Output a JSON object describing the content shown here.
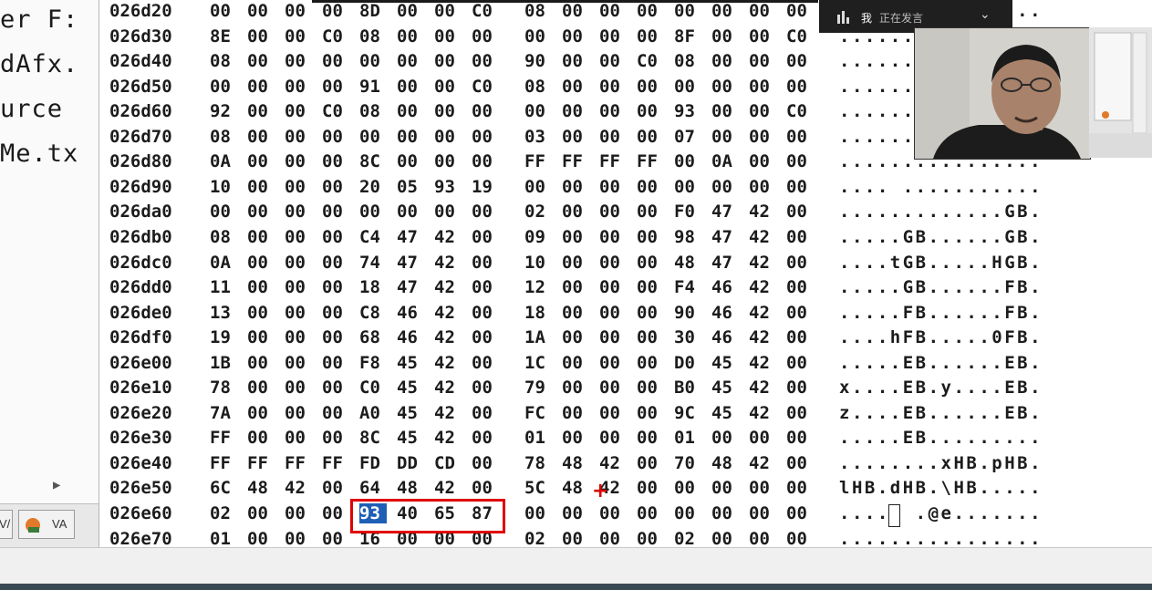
{
  "file_tree": {
    "items": [
      "er F:",
      "dAfx.",
      "urce ",
      "Me.tx"
    ],
    "tabs": [
      "V/",
      "VA"
    ]
  },
  "meeting": {
    "speaker": "我",
    "status": "正在发言"
  },
  "hex": {
    "selected_bytes": [
      "93",
      "40",
      "65",
      "87"
    ],
    "rows": [
      {
        "addr": "026d20",
        "bytes": [
          "00",
          "00",
          "00",
          "00",
          "8D",
          "00",
          "00",
          "C0",
          "08",
          "00",
          "00",
          "00",
          "00",
          "00",
          "00",
          "00"
        ],
        "ascii": "....  .........."
      },
      {
        "addr": "026d30",
        "bytes": [
          "8E",
          "00",
          "00",
          "C0",
          "08",
          "00",
          "00",
          "00",
          "00",
          "00",
          "00",
          "00",
          "8F",
          "00",
          "00",
          "C0"
        ],
        "ascii": "................"
      },
      {
        "addr": "026d40",
        "bytes": [
          "08",
          "00",
          "00",
          "00",
          "00",
          "00",
          "00",
          "00",
          "90",
          "00",
          "00",
          "C0",
          "08",
          "00",
          "00",
          "00"
        ],
        "ascii": "................"
      },
      {
        "addr": "026d50",
        "bytes": [
          "00",
          "00",
          "00",
          "00",
          "91",
          "00",
          "00",
          "C0",
          "08",
          "00",
          "00",
          "00",
          "00",
          "00",
          "00",
          "00"
        ],
        "ascii": "................"
      },
      {
        "addr": "026d60",
        "bytes": [
          "92",
          "00",
          "00",
          "C0",
          "08",
          "00",
          "00",
          "00",
          "00",
          "00",
          "00",
          "00",
          "93",
          "00",
          "00",
          "C0"
        ],
        "ascii": "................"
      },
      {
        "addr": "026d70",
        "bytes": [
          "08",
          "00",
          "00",
          "00",
          "00",
          "00",
          "00",
          "00",
          "03",
          "00",
          "00",
          "00",
          "07",
          "00",
          "00",
          "00"
        ],
        "ascii": "................"
      },
      {
        "addr": "026d80",
        "bytes": [
          "0A",
          "00",
          "00",
          "00",
          "8C",
          "00",
          "00",
          "00",
          "FF",
          "FF",
          "FF",
          "FF",
          "00",
          "0A",
          "00",
          "00"
        ],
        "ascii": "................"
      },
      {
        "addr": "026d90",
        "bytes": [
          "10",
          "00",
          "00",
          "00",
          "20",
          "05",
          "93",
          "19",
          "00",
          "00",
          "00",
          "00",
          "00",
          "00",
          "00",
          "00"
        ],
        "ascii": ".... ..........."
      },
      {
        "addr": "026da0",
        "bytes": [
          "00",
          "00",
          "00",
          "00",
          "00",
          "00",
          "00",
          "00",
          "02",
          "00",
          "00",
          "00",
          "F0",
          "47",
          "42",
          "00"
        ],
        "ascii": ".............GB."
      },
      {
        "addr": "026db0",
        "bytes": [
          "08",
          "00",
          "00",
          "00",
          "C4",
          "47",
          "42",
          "00",
          "09",
          "00",
          "00",
          "00",
          "98",
          "47",
          "42",
          "00"
        ],
        "ascii": ".....GB......GB."
      },
      {
        "addr": "026dc0",
        "bytes": [
          "0A",
          "00",
          "00",
          "00",
          "74",
          "47",
          "42",
          "00",
          "10",
          "00",
          "00",
          "00",
          "48",
          "47",
          "42",
          "00"
        ],
        "ascii": "....tGB.....HGB."
      },
      {
        "addr": "026dd0",
        "bytes": [
          "11",
          "00",
          "00",
          "00",
          "18",
          "47",
          "42",
          "00",
          "12",
          "00",
          "00",
          "00",
          "F4",
          "46",
          "42",
          "00"
        ],
        "ascii": ".....GB......FB."
      },
      {
        "addr": "026de0",
        "bytes": [
          "13",
          "00",
          "00",
          "00",
          "C8",
          "46",
          "42",
          "00",
          "18",
          "00",
          "00",
          "00",
          "90",
          "46",
          "42",
          "00"
        ],
        "ascii": ".....FB......FB."
      },
      {
        "addr": "026df0",
        "bytes": [
          "19",
          "00",
          "00",
          "00",
          "68",
          "46",
          "42",
          "00",
          "1A",
          "00",
          "00",
          "00",
          "30",
          "46",
          "42",
          "00"
        ],
        "ascii": "....hFB.....0FB."
      },
      {
        "addr": "026e00",
        "bytes": [
          "1B",
          "00",
          "00",
          "00",
          "F8",
          "45",
          "42",
          "00",
          "1C",
          "00",
          "00",
          "00",
          "D0",
          "45",
          "42",
          "00"
        ],
        "ascii": ".....EB......EB."
      },
      {
        "addr": "026e10",
        "bytes": [
          "78",
          "00",
          "00",
          "00",
          "C0",
          "45",
          "42",
          "00",
          "79",
          "00",
          "00",
          "00",
          "B0",
          "45",
          "42",
          "00"
        ],
        "ascii": "x....EB.y....EB."
      },
      {
        "addr": "026e20",
        "bytes": [
          "7A",
          "00",
          "00",
          "00",
          "A0",
          "45",
          "42",
          "00",
          "FC",
          "00",
          "00",
          "00",
          "9C",
          "45",
          "42",
          "00"
        ],
        "ascii": "z....EB......EB."
      },
      {
        "addr": "026e30",
        "bytes": [
          "FF",
          "00",
          "00",
          "00",
          "8C",
          "45",
          "42",
          "00",
          "01",
          "00",
          "00",
          "00",
          "01",
          "00",
          "00",
          "00"
        ],
        "ascii": ".....EB........."
      },
      {
        "addr": "026e40",
        "bytes": [
          "FF",
          "FF",
          "FF",
          "FF",
          "FD",
          "DD",
          "CD",
          "00",
          "78",
          "48",
          "42",
          "00",
          "70",
          "48",
          "42",
          "00"
        ],
        "ascii": "........xHB.pHB."
      },
      {
        "addr": "026e50",
        "bytes": [
          "6C",
          "48",
          "42",
          "00",
          "64",
          "48",
          "42",
          "00",
          "5C",
          "48",
          "42",
          "00",
          "00",
          "00",
          "00",
          "00"
        ],
        "ascii": "lHB.dHB.\\HB....."
      },
      {
        "addr": "026e60",
        "bytes": [
          "02",
          "00",
          "00",
          "00",
          "93",
          "40",
          "65",
          "87",
          "00",
          "00",
          "00",
          "00",
          "00",
          "00",
          "00",
          "00"
        ],
        "ascii": "....  .@e......."
      },
      {
        "addr": "026e70",
        "bytes": [
          "01",
          "00",
          "00",
          "00",
          "16",
          "00",
          "00",
          "00",
          "02",
          "00",
          "00",
          "00",
          "02",
          "00",
          "00",
          "00"
        ],
        "ascii": "................"
      }
    ]
  }
}
